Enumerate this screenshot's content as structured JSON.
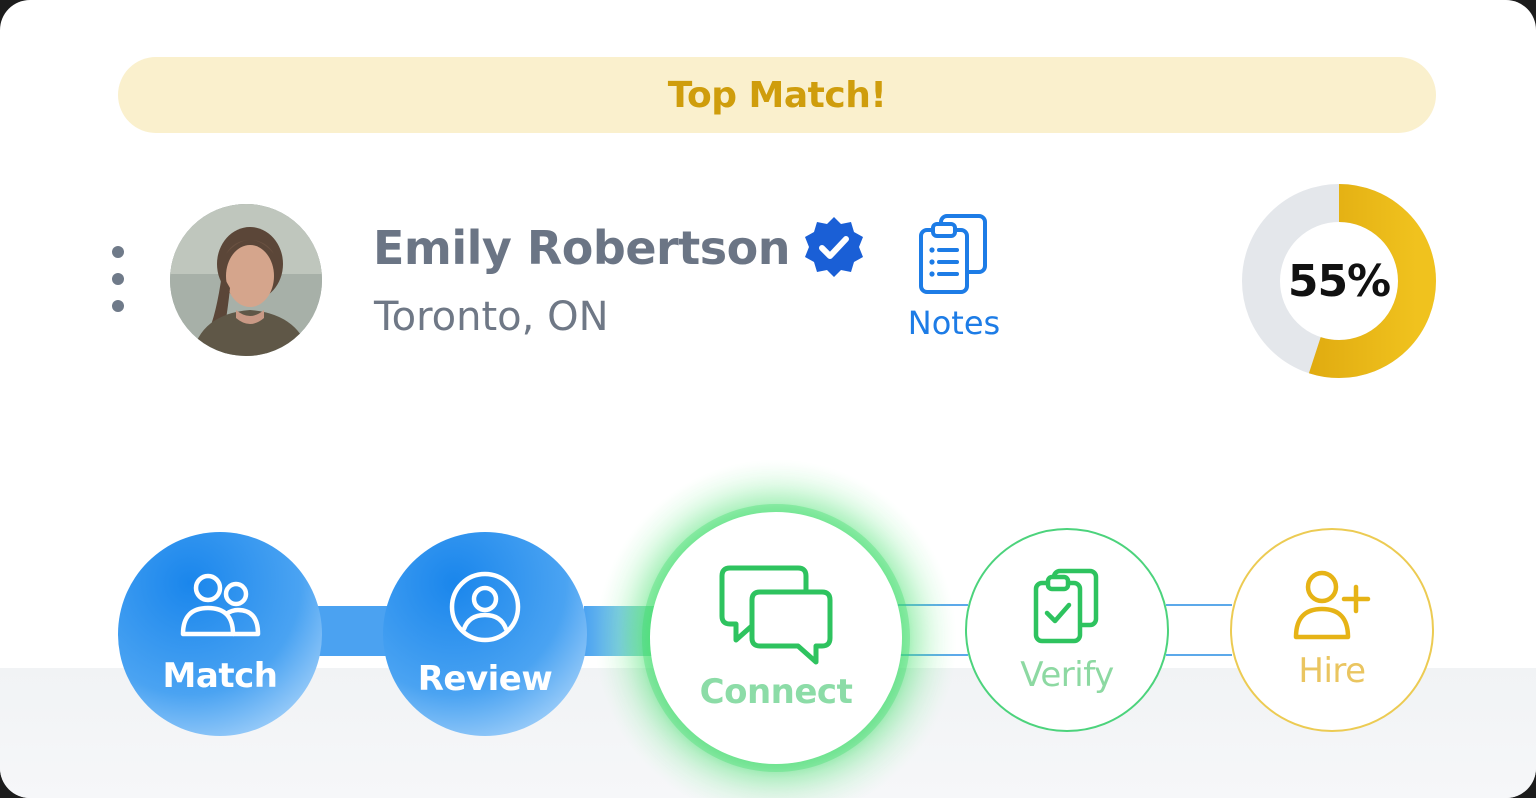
{
  "banner": {
    "text": "Top Match!"
  },
  "candidate": {
    "name": "Emily Robertson",
    "location": "Toronto, ON",
    "verified": true
  },
  "notes": {
    "label": "Notes",
    "icon": "clipboard-list-icon"
  },
  "match_score": {
    "label": "55%",
    "value": 55
  },
  "steps": [
    {
      "label": "Match",
      "icon": "users-icon",
      "state": "complete"
    },
    {
      "label": "Review",
      "icon": "user-circle-icon",
      "state": "complete"
    },
    {
      "label": "Connect",
      "icon": "chat-bubbles-icon",
      "state": "active"
    },
    {
      "label": "Verify",
      "icon": "clipboard-check-icon",
      "state": "pending"
    },
    {
      "label": "Hire",
      "icon": "user-plus-icon",
      "state": "pending"
    }
  ],
  "colors": {
    "banner_bg": "#faf0cd",
    "banner_text": "#cf9d0c",
    "blue": "#1a86ec",
    "green": "#2ec35f",
    "gold": "#e6b316",
    "notes": "#1d7ce6"
  }
}
